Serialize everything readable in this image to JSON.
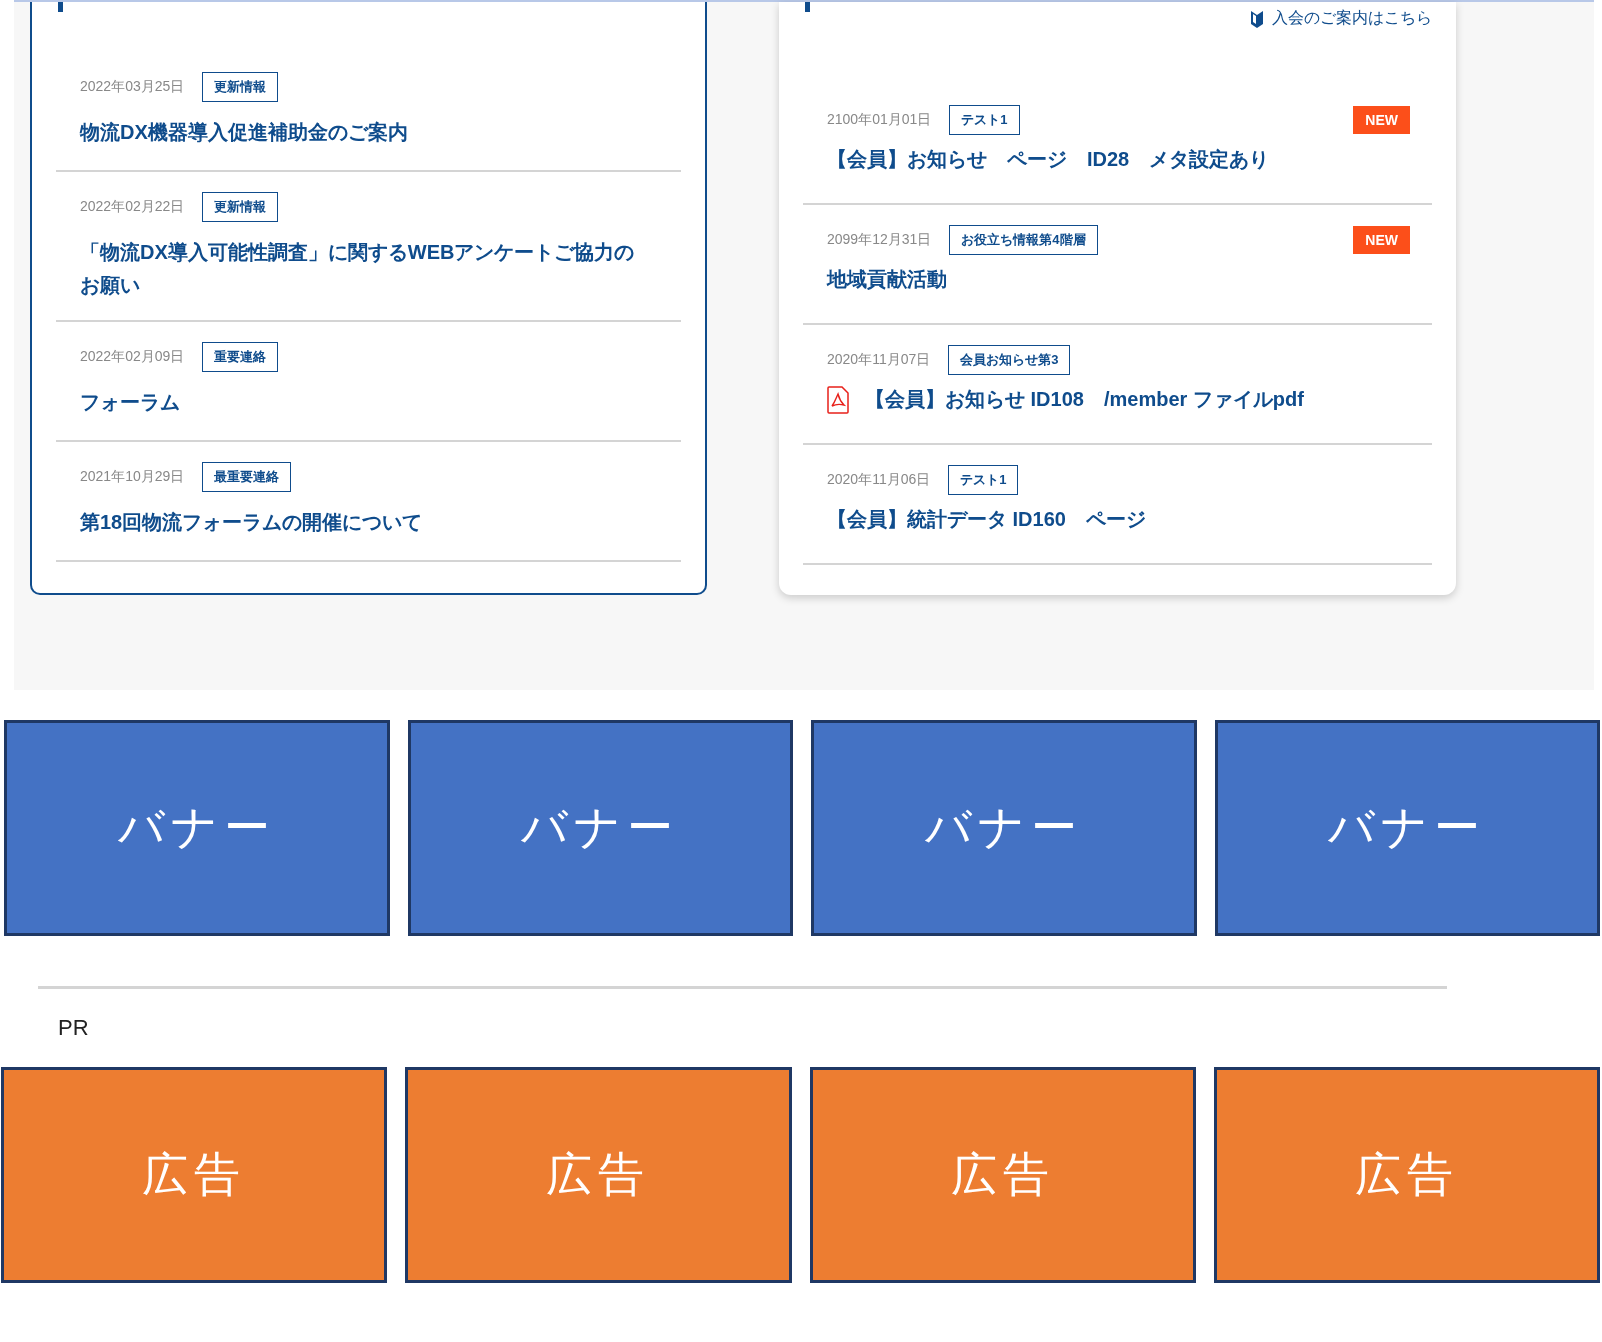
{
  "news": {
    "items": [
      {
        "date": "2022年03月25日",
        "tag": "更新情報",
        "title": "物流DX機器導入促進補助金のご案内"
      },
      {
        "date": "2022年02月22日",
        "tag": "更新情報",
        "title": "「物流DX導入可能性調査」に関するWEBアンケートご協力のお願い"
      },
      {
        "date": "2022年02月09日",
        "tag": "重要連絡",
        "title": "フォーラム"
      },
      {
        "date": "2021年10月29日",
        "tag": "最重要連絡",
        "title": "第18回物流フォーラムの開催について"
      }
    ]
  },
  "members": {
    "join_link": "入会のご案内はこちら",
    "items": [
      {
        "date": "2100年01月01日",
        "tag": "テスト1",
        "kind": "page",
        "new": true,
        "new_label": "NEW",
        "title": "【会員】お知らせ　ページ　ID28　メタ設定あり"
      },
      {
        "date": "2099年12月31日",
        "tag": "お役立ち情報第4階層",
        "kind": "page",
        "new": true,
        "new_label": "NEW",
        "title": "地域貢献活動"
      },
      {
        "date": "2020年11月07日",
        "tag": "会員お知らせ第3",
        "kind": "pdf",
        "new": false,
        "title": "【会員】お知らせ ID108　/member ファイルpdf"
      },
      {
        "date": "2020年11月06日",
        "tag": "テスト1",
        "kind": "page",
        "new": false,
        "title": "【会員】統計データ ID160　ページ"
      }
    ]
  },
  "banners": [
    "バナー",
    "バナー",
    "バナー",
    "バナー"
  ],
  "pr_label": "PR",
  "ads": [
    "広告",
    "広告",
    "広告",
    "広告"
  ]
}
